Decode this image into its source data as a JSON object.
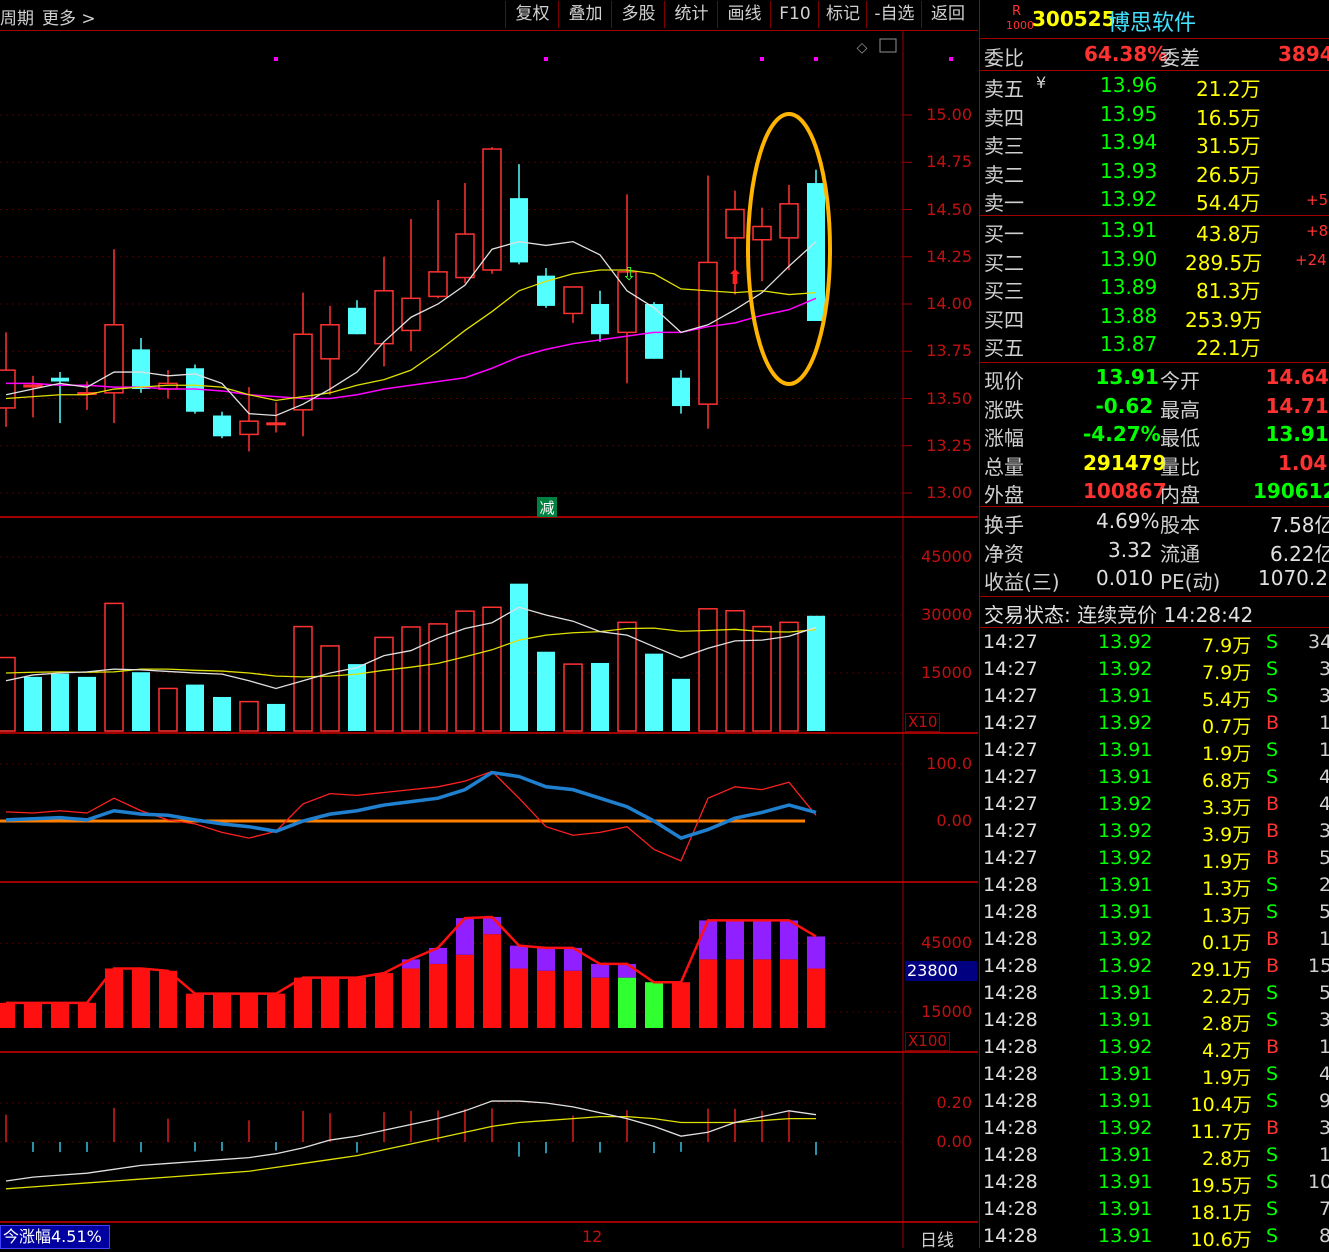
{
  "toolbar": {
    "period_label": "周期",
    "more_label": "更多",
    "buttons": [
      "复权",
      "叠加",
      "多股",
      "统计",
      "画线",
      "F10",
      "标记",
      "-自选",
      "返回"
    ]
  },
  "main_chart": {
    "price_axis": [
      "15.00",
      "14.75",
      "14.50",
      "14.25",
      "14.00",
      "13.75",
      "13.50",
      "13.25",
      "13.00"
    ],
    "event_label": "减"
  },
  "volume_chart": {
    "axis": [
      "45000",
      "30000",
      "15000"
    ],
    "multiplier": "X10"
  },
  "indicator1": {
    "axis": [
      "100.0",
      "0.00"
    ]
  },
  "indicator2": {
    "axis": [
      "45000",
      "15000"
    ],
    "marker": "23800",
    "multiplier": "X100"
  },
  "indicator3": {
    "axis": [
      "0.20",
      "0.00"
    ]
  },
  "bottom": {
    "today_change": "今涨幅4.51%",
    "date_label": "12",
    "period": "日线"
  },
  "stock": {
    "badge_top": "R",
    "badge_bottom": "1000",
    "code": "300525",
    "name": "博思软件",
    "weibi_label": "委比",
    "weibi_value": "64.38%",
    "weicha_label": "委差",
    "weicha_value": "3894",
    "asks": [
      {
        "label": "卖五",
        "price": "13.96",
        "vol": "21.2万",
        "extra": ""
      },
      {
        "label": "卖四",
        "price": "13.95",
        "vol": "16.5万",
        "extra": ""
      },
      {
        "label": "卖三",
        "price": "13.94",
        "vol": "31.5万",
        "extra": ""
      },
      {
        "label": "卖二",
        "price": "13.93",
        "vol": "26.5万",
        "extra": ""
      },
      {
        "label": "卖一",
        "price": "13.92",
        "vol": "54.4万",
        "extra": "+5"
      }
    ],
    "bids": [
      {
        "label": "买一",
        "price": "13.91",
        "vol": "43.8万",
        "extra": "+8"
      },
      {
        "label": "买二",
        "price": "13.90",
        "vol": "289.5万",
        "extra": "+24"
      },
      {
        "label": "买三",
        "price": "13.89",
        "vol": "81.3万",
        "extra": ""
      },
      {
        "label": "买四",
        "price": "13.88",
        "vol": "253.9万",
        "extra": ""
      },
      {
        "label": "买五",
        "price": "13.87",
        "vol": "22.1万",
        "extra": ""
      }
    ],
    "quote": [
      {
        "l1": "现价",
        "v1": "13.91",
        "c1": "green",
        "l2": "今开",
        "v2": "14.64",
        "c2": "red"
      },
      {
        "l1": "涨跌",
        "v1": "-0.62",
        "c1": "green",
        "l2": "最高",
        "v2": "14.71",
        "c2": "red"
      },
      {
        "l1": "涨幅",
        "v1": "-4.27%",
        "c1": "green",
        "l2": "最低",
        "v2": "13.91",
        "c2": "green"
      },
      {
        "l1": "总量",
        "v1": "291479",
        "c1": "yellow",
        "l2": "量比",
        "v2": "1.04",
        "c2": "red"
      },
      {
        "l1": "外盘",
        "v1": "100867",
        "c1": "red",
        "l2": "内盘",
        "v2": "190612",
        "c2": "green"
      }
    ],
    "fundamentals": [
      {
        "l1": "换手",
        "v1": "4.69%",
        "l2": "股本",
        "v2": "7.58亿"
      },
      {
        "l1": "净资",
        "v1": "3.32",
        "l2": "流通",
        "v2": "6.22亿"
      },
      {
        "l1": "收益(三)",
        "v1": "0.010",
        "l2": "PE(动)",
        "v2": "1070.2"
      }
    ],
    "trade_status": "交易状态: 连续竞价 14:28:42"
  },
  "ticks": [
    {
      "time": "14:27",
      "price": "13.92",
      "vol": "7.9万",
      "side": "S",
      "n": "34"
    },
    {
      "time": "14:27",
      "price": "13.92",
      "vol": "7.9万",
      "side": "S",
      "n": "3"
    },
    {
      "time": "14:27",
      "price": "13.91",
      "vol": "5.4万",
      "side": "S",
      "n": "3"
    },
    {
      "time": "14:27",
      "price": "13.92",
      "vol": "0.7万",
      "side": "B",
      "n": "1"
    },
    {
      "time": "14:27",
      "price": "13.91",
      "vol": "1.9万",
      "side": "S",
      "n": "1"
    },
    {
      "time": "14:27",
      "price": "13.91",
      "vol": "6.8万",
      "side": "S",
      "n": "4"
    },
    {
      "time": "14:27",
      "price": "13.92",
      "vol": "3.3万",
      "side": "B",
      "n": "4"
    },
    {
      "time": "14:27",
      "price": "13.92",
      "vol": "3.9万",
      "side": "B",
      "n": "3"
    },
    {
      "time": "14:27",
      "price": "13.92",
      "vol": "1.9万",
      "side": "B",
      "n": "5"
    },
    {
      "time": "14:28",
      "price": "13.91",
      "vol": "1.3万",
      "side": "S",
      "n": "2"
    },
    {
      "time": "14:28",
      "price": "13.91",
      "vol": "1.3万",
      "side": "S",
      "n": "5"
    },
    {
      "time": "14:28",
      "price": "13.92",
      "vol": "0.1万",
      "side": "B",
      "n": "1"
    },
    {
      "time": "14:28",
      "price": "13.92",
      "vol": "29.1万",
      "side": "B",
      "n": "15"
    },
    {
      "time": "14:28",
      "price": "13.91",
      "vol": "2.2万",
      "side": "S",
      "n": "5"
    },
    {
      "time": "14:28",
      "price": "13.91",
      "vol": "2.8万",
      "side": "S",
      "n": "3"
    },
    {
      "time": "14:28",
      "price": "13.92",
      "vol": "4.2万",
      "side": "B",
      "n": "1"
    },
    {
      "time": "14:28",
      "price": "13.91",
      "vol": "1.9万",
      "side": "S",
      "n": "4"
    },
    {
      "time": "14:28",
      "price": "13.91",
      "vol": "10.4万",
      "side": "S",
      "n": "9"
    },
    {
      "time": "14:28",
      "price": "13.92",
      "vol": "11.7万",
      "side": "B",
      "n": "3"
    },
    {
      "time": "14:28",
      "price": "13.91",
      "vol": "2.8万",
      "side": "S",
      "n": "1"
    },
    {
      "time": "14:28",
      "price": "13.91",
      "vol": "19.5万",
      "side": "S",
      "n": "10"
    },
    {
      "time": "14:28",
      "price": "13.91",
      "vol": "18.1万",
      "side": "S",
      "n": "7"
    },
    {
      "time": "14:28",
      "price": "13.91",
      "vol": "10.6万",
      "side": "S",
      "n": "8"
    }
  ],
  "chart_data": {
    "type": "candlestick",
    "colors": {
      "up": "#ff3232",
      "down": "#54ffff",
      "ma5": "#e0e0e0",
      "ma10": "#e0e000",
      "ma20": "#ff00ff",
      "highlight": "#ffb400"
    },
    "candles": [
      {
        "o": 13.45,
        "c": 13.65,
        "h": 13.85,
        "l": 13.35
      },
      {
        "o": 13.57,
        "c": 13.57,
        "h": 13.62,
        "l": 13.4
      },
      {
        "o": 13.61,
        "c": 13.59,
        "h": 13.64,
        "l": 13.37
      },
      {
        "o": 13.53,
        "c": 13.53,
        "h": 13.59,
        "l": 13.44
      },
      {
        "o": 13.53,
        "c": 13.89,
        "h": 14.29,
        "l": 13.37
      },
      {
        "o": 13.76,
        "c": 13.55,
        "h": 13.82,
        "l": 13.53
      },
      {
        "o": 13.55,
        "c": 13.58,
        "h": 13.65,
        "l": 13.5
      },
      {
        "o": 13.66,
        "c": 13.43,
        "h": 13.68,
        "l": 13.42
      },
      {
        "o": 13.41,
        "c": 13.3,
        "h": 13.43,
        "l": 13.29
      },
      {
        "o": 13.31,
        "c": 13.38,
        "h": 13.56,
        "l": 13.22
      },
      {
        "o": 13.37,
        "c": 13.37,
        "h": 13.48,
        "l": 13.32
      },
      {
        "o": 13.44,
        "c": 13.84,
        "h": 14.06,
        "l": 13.3
      },
      {
        "o": 13.71,
        "c": 13.89,
        "h": 13.99,
        "l": 13.52
      },
      {
        "o": 13.98,
        "c": 13.84,
        "h": 14.02,
        "l": 13.84
      },
      {
        "o": 13.79,
        "c": 14.07,
        "h": 14.25,
        "l": 13.67
      },
      {
        "o": 13.86,
        "c": 14.03,
        "h": 14.45,
        "l": 13.75
      },
      {
        "o": 14.04,
        "c": 14.17,
        "h": 14.55,
        "l": 14.03
      },
      {
        "o": 14.14,
        "c": 14.37,
        "h": 14.64,
        "l": 14.11
      },
      {
        "o": 14.18,
        "c": 14.82,
        "h": 14.83,
        "l": 14.16
      },
      {
        "o": 14.56,
        "c": 14.22,
        "h": 14.74,
        "l": 14.21
      },
      {
        "o": 14.15,
        "c": 13.99,
        "h": 14.19,
        "l": 13.98
      },
      {
        "o": 13.95,
        "c": 14.09,
        "h": 14.09,
        "l": 13.9
      },
      {
        "o": 14.0,
        "c": 13.84,
        "h": 14.07,
        "l": 13.8
      },
      {
        "o": 13.85,
        "c": 14.17,
        "h": 14.58,
        "l": 13.58
      },
      {
        "o": 14.0,
        "c": 13.71,
        "h": 14.01,
        "l": 13.71
      },
      {
        "o": 13.61,
        "c": 13.46,
        "h": 13.65,
        "l": 13.42
      },
      {
        "o": 13.47,
        "c": 14.22,
        "h": 14.68,
        "l": 13.34
      },
      {
        "o": 14.35,
        "c": 14.5,
        "h": 14.6,
        "l": 14.05
      },
      {
        "o": 14.34,
        "c": 14.41,
        "h": 14.51,
        "l": 14.12
      },
      {
        "o": 14.35,
        "c": 14.53,
        "h": 14.63,
        "l": 14.18
      },
      {
        "o": 14.64,
        "c": 13.91,
        "h": 14.71,
        "l": 13.91
      }
    ],
    "ma5": [
      13.52,
      13.55,
      13.58,
      13.56,
      13.64,
      13.64,
      13.62,
      13.63,
      13.58,
      13.42,
      13.41,
      13.47,
      13.55,
      13.64,
      13.8,
      13.93,
      14.0,
      14.1,
      14.29,
      14.33,
      14.31,
      14.33,
      14.26,
      14.07,
      13.98,
      13.85,
      13.89,
      13.97,
      14.06,
      14.2,
      14.33
    ],
    "ma10": [
      13.5,
      13.51,
      13.52,
      13.52,
      13.55,
      13.56,
      13.57,
      13.57,
      13.56,
      13.52,
      13.49,
      13.51,
      13.53,
      13.57,
      13.6,
      13.65,
      13.75,
      13.86,
      13.96,
      14.07,
      14.12,
      14.16,
      14.18,
      14.18,
      14.16,
      14.08,
      14.07,
      14.06,
      14.07,
      14.05,
      14.06
    ],
    "ma20": [
      13.58,
      13.58,
      13.57,
      13.57,
      13.56,
      13.56,
      13.55,
      13.55,
      13.54,
      13.52,
      13.51,
      13.5,
      13.5,
      13.52,
      13.55,
      13.57,
      13.59,
      13.61,
      13.66,
      13.72,
      13.76,
      13.79,
      13.81,
      13.83,
      13.85,
      13.85,
      13.88,
      13.9,
      13.94,
      13.97,
      14.03
    ],
    "volume": [
      19000,
      14000,
      14800,
      14000,
      33000,
      15200,
      11000,
      12000,
      8800,
      7600,
      7000,
      27000,
      22000,
      17300,
      24200,
      26900,
      27700,
      31000,
      32000,
      38100,
      20500,
      17300,
      17600,
      28100,
      20000,
      13500,
      31600,
      31100,
      27000,
      28100,
      29800
    ],
    "vol_ma5": [
      13000,
      14500,
      15000,
      15300,
      16000,
      15800,
      15400,
      15000,
      14700,
      13000,
      11000,
      13000,
      15000,
      16400,
      19500,
      20800,
      24000,
      26500,
      28000,
      32000,
      30000,
      28400,
      25700,
      24800,
      21800,
      18900,
      21400,
      23300,
      23500,
      24500,
      26800
    ],
    "vol_ma10": [
      15000,
      15200,
      15300,
      15200,
      15300,
      16000,
      16000,
      15700,
      15500,
      15000,
      14200,
      14000,
      14200,
      14700,
      15700,
      16500,
      17500,
      19200,
      21000,
      23500,
      24800,
      25400,
      25700,
      26500,
      26600,
      25800,
      26000,
      26300,
      25700,
      25600,
      26200
    ],
    "volume_up": [
      true,
      false,
      false,
      false,
      true,
      false,
      true,
      false,
      false,
      true,
      false,
      true,
      true,
      false,
      true,
      true,
      true,
      true,
      true,
      false,
      false,
      true,
      false,
      true,
      false,
      false,
      true,
      true,
      true,
      true,
      false
    ],
    "ind1_red": [
      16,
      14,
      18,
      14,
      40,
      18,
      2,
      -5,
      -20,
      -30,
      -18,
      30,
      48,
      45,
      50,
      55,
      60,
      70,
      87,
      40,
      -10,
      -25,
      -20,
      -10,
      -50,
      -70,
      40,
      60,
      55,
      68,
      10
    ],
    "ind1_blue": [
      2,
      4,
      6,
      2,
      18,
      12,
      10,
      2,
      -5,
      -10,
      -18,
      0,
      12,
      18,
      28,
      34,
      40,
      55,
      85,
      78,
      60,
      55,
      40,
      25,
      0,
      -30,
      -15,
      5,
      15,
      28,
      15
    ],
    "ind2_red_top": [
      19000,
      19000,
      19000,
      19000,
      34000,
      34000,
      33000,
      23000,
      23000,
      23000,
      23000,
      30000,
      30000,
      30000,
      32000,
      34000,
      36000,
      40000,
      49000,
      34000,
      33000,
      33000,
      30000,
      30000,
      28000,
      28000,
      38000,
      38000,
      38000,
      38000,
      34000
    ],
    "ind2_purple_top": [
      19000,
      19000,
      19000,
      19000,
      34000,
      34000,
      33000,
      23000,
      23000,
      23000,
      23000,
      30000,
      30000,
      30000,
      32000,
      38000,
      43000,
      56000,
      67000,
      44000,
      43000,
      43000,
      36000,
      36000,
      28000,
      28000,
      55000,
      55000,
      55000,
      55000,
      48000
    ],
    "ind3_white": [
      -0.2,
      -0.18,
      -0.17,
      -0.16,
      -0.14,
      -0.12,
      -0.11,
      -0.1,
      -0.09,
      -0.08,
      -0.06,
      -0.03,
      0.01,
      0.03,
      0.06,
      0.09,
      0.12,
      0.16,
      0.21,
      0.21,
      0.2,
      0.18,
      0.15,
      0.12,
      0.08,
      0.03,
      0.05,
      0.1,
      0.13,
      0.16,
      0.14
    ],
    "ind3_yellow": [
      -0.24,
      -0.23,
      -0.22,
      -0.21,
      -0.2,
      -0.19,
      -0.18,
      -0.17,
      -0.16,
      -0.15,
      -0.13,
      -0.11,
      -0.09,
      -0.07,
      -0.04,
      -0.01,
      0.02,
      0.05,
      0.08,
      0.1,
      0.11,
      0.12,
      0.13,
      0.13,
      0.12,
      0.1,
      0.1,
      0.1,
      0.11,
      0.12,
      0.12
    ],
    "x_tick": "12"
  }
}
